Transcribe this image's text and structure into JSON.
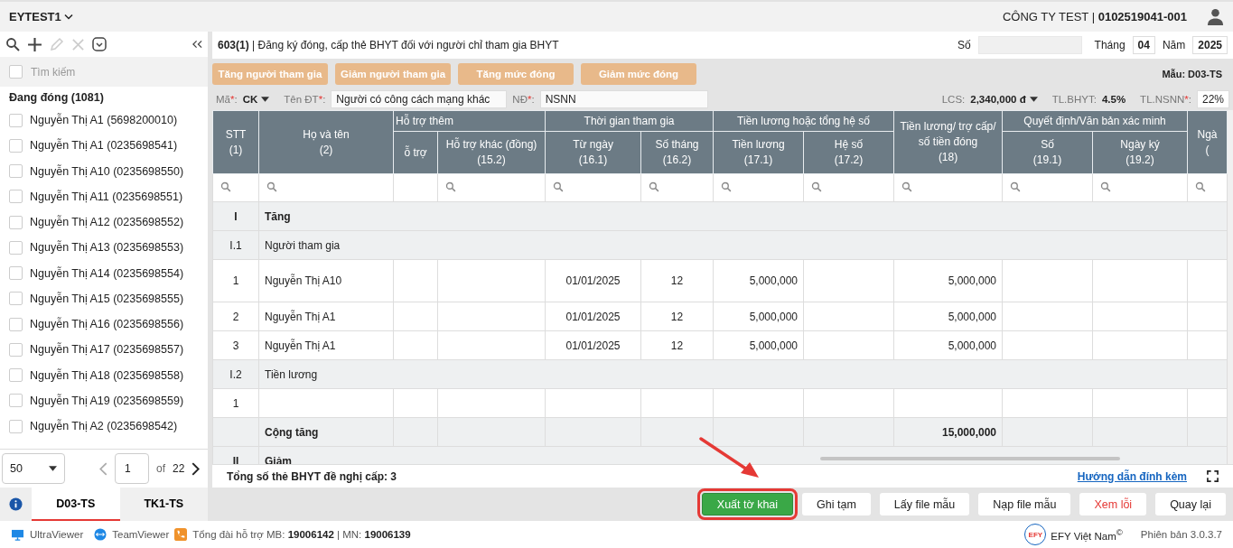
{
  "top_bar": {
    "workspace": "EYTEST1",
    "company": "CÔNG TY TEST | **0102519041-001**"
  },
  "sidebar": {
    "search": {
      "placeholder": "Tìm kiếm",
      "checked": false
    },
    "group": "Đang đóng (1081)",
    "items": [
      {
        "label": "Nguyễn Thị A1 (5698200010)",
        "checked": false
      },
      {
        "label": "Nguyễn Thị A1 (0235698541)",
        "checked": false
      },
      {
        "label": "Nguyễn Thị A10 (0235698550)",
        "checked": false
      },
      {
        "label": "Nguyễn Thị A11 (0235698551)",
        "checked": false
      },
      {
        "label": "Nguyễn Thị A12 (0235698552)",
        "checked": false
      },
      {
        "label": "Nguyễn Thị A13 (0235698553)",
        "checked": false
      },
      {
        "label": "Nguyễn Thị A14 (0235698554)",
        "checked": false
      },
      {
        "label": "Nguyễn Thị A15 (0235698555)",
        "checked": false
      },
      {
        "label": "Nguyễn Thị A16 (0235698556)",
        "checked": false
      },
      {
        "label": "Nguyễn Thị A17 (0235698557)",
        "checked": false
      },
      {
        "label": "Nguyễn Thị A18 (0235698558)",
        "checked": false
      },
      {
        "label": "Nguyễn Thị A19 (0235698559)",
        "checked": false
      },
      {
        "label": "Nguyễn Thị A2 (0235698542)",
        "checked": false
      }
    ],
    "pager": {
      "page_size": "50",
      "page": "1",
      "of": "of",
      "total": "22"
    },
    "tabs": [
      {
        "label": "D03-TS",
        "selected": true
      },
      {
        "label": "TK1-TS",
        "selected": false
      }
    ]
  },
  "form": {
    "title": "**603(1)** | Đăng ký đóng, cấp thẻ BHYT đối với người chỉ tham gia BHYT",
    "number_label": "Số",
    "month_label": "Tháng",
    "month": "04",
    "year_label": "Năm",
    "year": "2025",
    "toolbar_buttons": [
      "Tăng người tham gia",
      "Giảm người tham gia",
      "Tăng mức đóng",
      "Giảm mức đóng"
    ],
    "template": "Mẫu: D03-TS",
    "filters_left": [
      {
        "label": "Mã",
        "mark": "*",
        "after": ":",
        "kind": "dropdown",
        "value": "CK"
      },
      {
        "label": "Tên ĐT",
        "mark": "*",
        "after": ":",
        "kind": "field",
        "value": "Người có công cách mạng khác"
      },
      {
        "label": "NĐ",
        "mark": "*",
        "after": ":",
        "kind": "field",
        "value": "NSNN"
      }
    ],
    "filters_right": [
      {
        "label": "LCS:",
        "kind": "dropdown",
        "value": "2,340,000 đ"
      },
      {
        "label": "TL.BHYT:",
        "kind": "text",
        "value": "4.5%"
      },
      {
        "label": "TL.NSNN",
        "mark": "*",
        "after": ":",
        "kind": "field",
        "value": "22%"
      }
    ]
  },
  "table": {
    "header": [
      {
        "label": "STT",
        "code": "(1)",
        "filterable": true
      },
      {
        "label": "Họ và tên",
        "code": "(2)",
        "filterable": true
      },
      {
        "group": "Hỗ trợ thêm",
        "columns": [
          {
            "label": "ỗ trợ",
            "filterable": false
          },
          {
            "label": "Hỗ trợ khác (đồng)",
            "code": "(15.2)",
            "filterable": true
          }
        ]
      },
      {
        "group": "Thời gian tham gia",
        "columns": [
          {
            "label": "Từ ngày",
            "code": "(16.1)",
            "filterable": true
          },
          {
            "label": "Số tháng",
            "code": "(16.2)",
            "filterable": true
          }
        ]
      },
      {
        "group": "Tiền lương hoặc tổng hệ số",
        "columns": [
          {
            "label": "Tiền lương",
            "code": "(17.1)",
            "filterable": true
          },
          {
            "label": "Hệ số",
            "code": "(17.2)",
            "filterable": true
          }
        ]
      },
      {
        "label": "Tiền lương/ trợ cấp/ số tiền đóng",
        "code": "(18)",
        "filterable": true
      },
      {
        "group": "Quyết định/Văn bản xác minh",
        "columns": [
          {
            "label": "Số",
            "code": "(19.1)",
            "filterable": true
          },
          {
            "label": "Ngày ký",
            "code": "(19.2)",
            "filterable": true
          }
        ]
      },
      {
        "label": "Ngà",
        "code": "(",
        "filterable": true
      }
    ],
    "rows": [
      {
        "kind": "group",
        "stt": "I",
        "label": "Tăng"
      },
      {
        "kind": "subgroup",
        "stt": "I.1",
        "label": "Người tham gia"
      },
      {
        "kind": "data",
        "tall": true,
        "cells": [
          "1",
          "Nguyễn Thị A10",
          null,
          null,
          "01/01/2025",
          "12",
          "5,000,000",
          null,
          "5,000,000",
          null,
          null,
          null
        ]
      },
      {
        "kind": "data",
        "tall": false,
        "cells": [
          "2",
          "Nguyễn Thị A1",
          null,
          null,
          "01/01/2025",
          "12",
          "5,000,000",
          null,
          "5,000,000",
          null,
          null,
          null
        ]
      },
      {
        "kind": "data",
        "tall": false,
        "cells": [
          "3",
          "Nguyễn Thị A1",
          null,
          null,
          "01/01/2025",
          "12",
          "5,000,000",
          null,
          "5,000,000",
          null,
          null,
          null
        ]
      },
      {
        "kind": "subgroup",
        "stt": "I.2",
        "label": "Tiền lương"
      },
      {
        "kind": "data",
        "tall": false,
        "cells": [
          "1",
          null,
          null,
          null,
          null,
          null,
          null,
          null,
          null,
          null,
          null,
          null
        ]
      },
      {
        "kind": "total",
        "cells": [
          null,
          "Cộng tăng",
          null,
          null,
          null,
          null,
          null,
          null,
          "15,000,000",
          null,
          null,
          null
        ]
      },
      {
        "kind": "group",
        "stt": "II",
        "label": "Giảm"
      }
    ]
  },
  "summary": {
    "text": "Tổng số thẻ BHYT đề nghị cấp: 3",
    "link": "Hướng dẫn đính kèm"
  },
  "actions": [
    {
      "label": "Xuất tờ khai",
      "kind": "primary",
      "highlighted": true
    },
    {
      "label": "Ghi tạm",
      "kind": "default",
      "highlighted": false
    },
    {
      "label": "Lấy file mẫu",
      "kind": "default",
      "highlighted": false
    },
    {
      "label": "Nạp file mẫu",
      "kind": "default",
      "highlighted": false
    },
    {
      "label": "Xem lỗi",
      "kind": "danger",
      "highlighted": false
    },
    {
      "label": "Quay lại",
      "kind": "default",
      "highlighted": false
    }
  ],
  "footer": {
    "links": [
      "UltraViewer",
      "TeamViewer"
    ],
    "hotline": "Tổng đài hỗ trợ MB: **19006142** | MN: **19006139**",
    "logo_text": "EFY",
    "brand": "EFY Việt Nam$^{©}$",
    "version": "Phiên bản 3.0.3.7"
  }
}
